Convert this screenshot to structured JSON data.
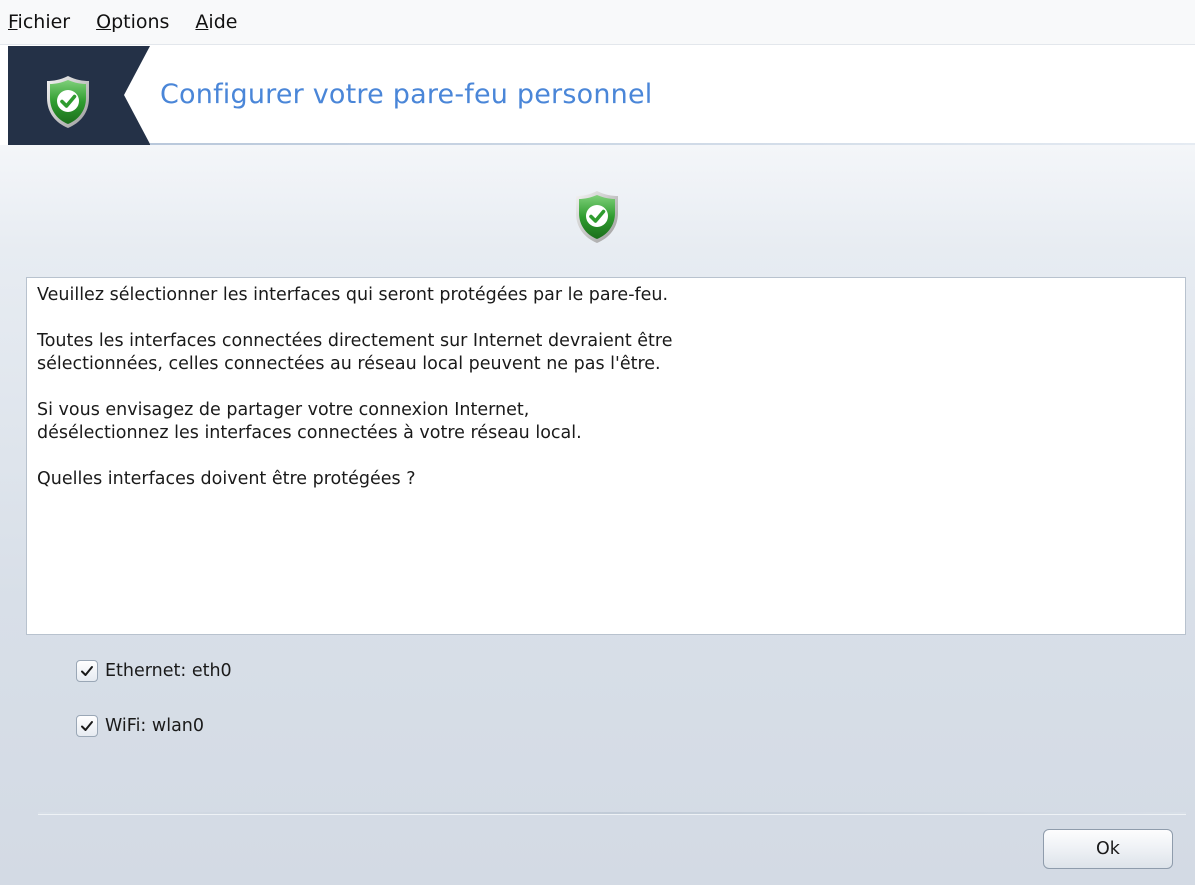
{
  "menu": {
    "items": [
      {
        "mnemonic": "F",
        "rest": "ichier"
      },
      {
        "mnemonic": "O",
        "rest": "ptions"
      },
      {
        "mnemonic": "A",
        "rest": "ide"
      }
    ]
  },
  "header": {
    "title": "Configurer votre pare-feu personnel",
    "icon": "shield-check-icon"
  },
  "center_icon": "shield-check-icon",
  "message": {
    "paragraphs": [
      "Veuillez sélectionner les interfaces qui seront protégées par le pare-feu.",
      "Toutes les interfaces connectées directement sur Internet devraient être\nsélectionnées, celles connectées au réseau local peuvent ne pas l'être.",
      "Si vous envisagez de partager votre connexion Internet,\ndésélectionnez les interfaces connectées à votre réseau local.",
      "Quelles interfaces doivent être protégées ?"
    ]
  },
  "interfaces": [
    {
      "label": "Ethernet: eth0",
      "checked": true
    },
    {
      "label": "WiFi: wlan0",
      "checked": true
    }
  ],
  "buttons": {
    "ok_label": "Ok"
  },
  "colors": {
    "title_blue": "#4a86d8",
    "banner_dark": "#243147",
    "shield_green": "#2e9a2e"
  }
}
